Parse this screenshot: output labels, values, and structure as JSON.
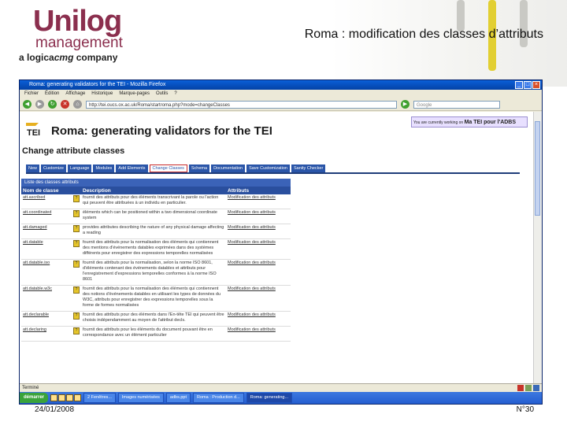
{
  "slide": {
    "logo_line1": "Unilog",
    "logo_line2": "management",
    "company_prefix": "a",
    "company_logica": "logica",
    "company_cmg": "cmg",
    "company_suffix": "company",
    "title": "Roma : modification des classes d’attributs",
    "date": "24/01/2008",
    "page_number": "N°30",
    "accent_color": "#8b2f4e"
  },
  "browser": {
    "window_title": "Roma: generating validators for the TEI - Mozilla Firefox",
    "menu": [
      "Fichier",
      "Édition",
      "Affichage",
      "Historique",
      "Marque-pages",
      "Outils",
      "?"
    ],
    "url": "http://tei.oucs.ox.ac.uk/Roma/startroma.php?mode=changeClasses",
    "search_placeholder": "Google",
    "status_text": "Terminé",
    "taskbar": {
      "start_label": "démarrer",
      "tasks": [
        "2 Fenêtres...",
        "Images numérisées",
        "adbs.ppt",
        "Roma : Production d...",
        "Roma: generating..."
      ]
    }
  },
  "page": {
    "working_label": "You are currently working on",
    "working_project": "Ma TEI pour l'ADBS",
    "logo_text": "TEI",
    "heading": "Roma: generating validators for the TEI",
    "subheading": "Change attribute classes",
    "tabs": [
      "New",
      "Customize",
      "Language",
      "Modules",
      "Add Elements",
      "Change Classes",
      "Schema",
      "Documentation",
      "Save Customization",
      "Sanity Checker"
    ],
    "active_tab": "Change Classes",
    "list_title": "Liste des classes attributs",
    "columns": {
      "name": "Nom de classe",
      "description": "Description",
      "attributes": "Attributs"
    },
    "rows": [
      {
        "name": "att.ascribed",
        "description": "fournit des attributs pour des éléments transcrivant la parole ou l'action qui peuvent être attribuées à un individu en particulier.",
        "attributes": "Modification des attributs"
      },
      {
        "name": "att.coordinated",
        "description": "éléments which can be positioned within a two dimensional coordinate system",
        "attributes": "Modification des attributs"
      },
      {
        "name": "att.damaged",
        "description": "provides attributes describing the nature of any physical damage affecting a reading",
        "attributes": "Modification des attributs"
      },
      {
        "name": "att.datable",
        "description": "fournit des attributs pour la normalisation des éléments qui contiennent des mentions d'événements datables exprimées dans des systèmes différents pour enregistrer des expressions temporelles normalisées",
        "attributes": "Modification des attributs"
      },
      {
        "name": "att.datable.iso",
        "description": "fournit des attributs pour la normalisation, selon la norme ISO 8601, d'éléments contenant des événements datables et attributs pour l'enregistrement d'expressions temporelles conformes à la norme ISO 8601",
        "attributes": "Modification des attributs"
      },
      {
        "name": "att.datable.w3c",
        "description": "fournit des attributs pour la normalisation des éléments qui contiennent des notions d'événements datables en utilisant les types de données du W3C, attributs pour enregistrer des expressions temporelles sous la forme de formes normalisées",
        "attributes": "Modification des attributs"
      },
      {
        "name": "att.declarable",
        "description": "fournit des attributs pour des éléments dans l'En-tête TEI qui peuvent être choisis indépendamment au moyen de l'attribut decls.",
        "attributes": "Modification des attributs"
      },
      {
        "name": "att.declaring",
        "description": "fournit des attributs pour les éléments du document pouvant être en correspondance avec un élément particulier",
        "attributes": "Modification des attributs"
      }
    ]
  }
}
